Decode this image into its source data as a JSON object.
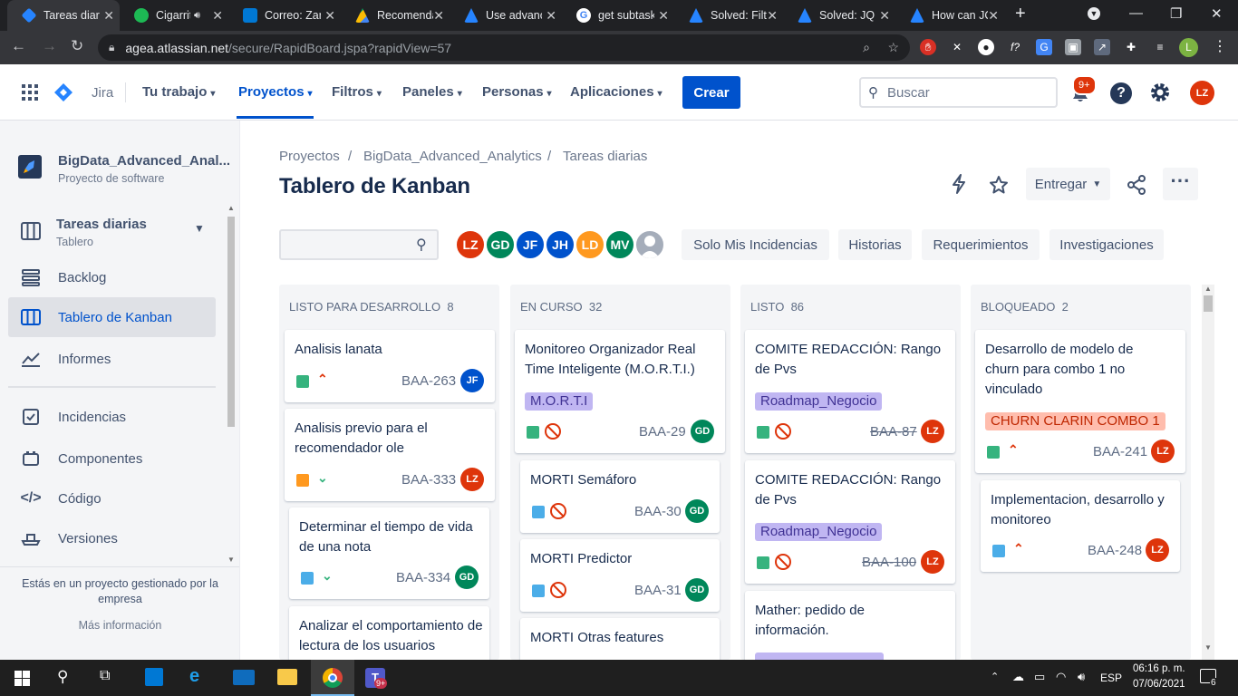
{
  "browser": {
    "tabs": [
      {
        "label": "Tareas diarias",
        "fav": "#2684ff",
        "active": true
      },
      {
        "label": "Cigarritos",
        "fav": "#1db954",
        "audio": true
      },
      {
        "label": "Correo: Zar",
        "fav": "#0078d4"
      },
      {
        "label": "Recomendac",
        "fav": "#fbbc04"
      },
      {
        "label": "Use advanced",
        "fav": "#2684ff"
      },
      {
        "label": "get subtasks",
        "fav": "#ffffff"
      },
      {
        "label": "Solved: Filter",
        "fav": "#2684ff"
      },
      {
        "label": "Solved: JQL",
        "fav": "#2684ff"
      },
      {
        "label": "How can JQL",
        "fav": "#2684ff"
      }
    ],
    "url_host": "agea.atlassian.net",
    "url_path": "/secure/RapidBoard.jspa?rapidView=57",
    "profile_initial": "L"
  },
  "header": {
    "product": "Jira",
    "nav": [
      {
        "label": "Tu trabajo",
        "selected": false
      },
      {
        "label": "Proyectos",
        "selected": true
      },
      {
        "label": "Filtros",
        "selected": false
      },
      {
        "label": "Paneles",
        "selected": false
      },
      {
        "label": "Personas",
        "selected": false
      },
      {
        "label": "Aplicaciones",
        "selected": false
      }
    ],
    "create_label": "Crear",
    "search_placeholder": "Buscar",
    "notif_badge": "9+",
    "user_initials": "LZ"
  },
  "sidebar": {
    "project_name": "BigData_Advanced_Anal...",
    "project_type": "Proyecto de software",
    "board_name": "Tareas diarias",
    "board_type": "Tablero",
    "items": [
      {
        "label": "Backlog",
        "icon": "backlog-icon"
      },
      {
        "label": "Tablero de Kanban",
        "icon": "board-icon",
        "selected": true
      },
      {
        "label": "Informes",
        "icon": "reports-icon"
      },
      {
        "label": "Incidencias",
        "icon": "issues-icon"
      },
      {
        "label": "Componentes",
        "icon": "components-icon"
      },
      {
        "label": "Código",
        "icon": "code-icon"
      },
      {
        "label": "Versiones",
        "icon": "releases-icon"
      }
    ],
    "footer_text": "Estás en un proyecto gestionado por la empresa",
    "more_info": "Más información"
  },
  "main": {
    "breadcrumb": [
      "Proyectos",
      "BigData_Advanced_Analytics",
      "Tareas diarias"
    ],
    "title": "Tablero de Kanban",
    "release_label": "Entregar",
    "avatars": [
      {
        "initials": "LZ",
        "color": "#de350b"
      },
      {
        "initials": "GD",
        "color": "#00875a"
      },
      {
        "initials": "JF",
        "color": "#0052cc"
      },
      {
        "initials": "JH",
        "color": "#0052cc"
      },
      {
        "initials": "LD",
        "color": "#ff991f"
      },
      {
        "initials": "MV",
        "color": "#00875a"
      }
    ],
    "quick_filters": [
      "Solo Mis Incidencias",
      "Historias",
      "Requerimientos",
      "Investigaciones"
    ],
    "columns": [
      {
        "name": "LISTO PARA DESARROLLO",
        "count": "8"
      },
      {
        "name": "EN CURSO",
        "count": "32"
      },
      {
        "name": "LISTO",
        "count": "86"
      },
      {
        "name": "BLOQUEADO",
        "count": "2"
      }
    ],
    "cards": {
      "c1": {
        "title": "Analisis lanata",
        "key": "BAA-263",
        "assignee": "JF"
      },
      "c2": {
        "title": "Analisis previo para el recomendador ole",
        "key": "BAA-333",
        "assignee": "LZ"
      },
      "c3": {
        "title": "Determinar el tiempo de vida de una nota",
        "key": "BAA-334",
        "assignee": "GD"
      },
      "c4": {
        "title": "Analizar el comportamiento de lectura de los usuarios",
        "key": "",
        "assignee": ""
      },
      "c5": {
        "title": "Monitoreo Organizador Real Time Inteligente (M.O.R.T.I.)",
        "epic": "M.O.R.T.I",
        "key": "BAA-29",
        "assignee": "GD"
      },
      "c6": {
        "title": "MORTI Semáforo",
        "key": "BAA-30",
        "assignee": "GD"
      },
      "c7": {
        "title": "MORTI Predictor",
        "key": "BAA-31",
        "assignee": "GD"
      },
      "c8": {
        "title": "MORTI Otras features",
        "key": "",
        "assignee": ""
      },
      "c9": {
        "title": "COMITE REDACCIÓN: Rango de Pvs",
        "epic": "Roadmap_Negocio",
        "key": "BAA-87",
        "assignee": "LZ"
      },
      "c10": {
        "title": "COMITE REDACCIÓN: Rango de Pvs",
        "epic": "Roadmap_Negocio",
        "key": "BAA-100",
        "assignee": "LZ"
      },
      "c11": {
        "title": "Mather: pedido de información.",
        "key": "",
        "assignee": ""
      },
      "c12": {
        "title": "Desarrollo de modelo de churn para combo 1 no vinculado",
        "epic": "CHURN CLARIN COMBO 1",
        "key": "BAA-241",
        "assignee": "LZ"
      },
      "c13": {
        "title": "Implementacion, desarrollo y monitoreo",
        "key": "BAA-248",
        "assignee": "LZ"
      }
    }
  },
  "taskbar": {
    "lang": "ESP",
    "time": "06:16 p. m.",
    "date": "07/06/2021",
    "notif_count": "6",
    "teams_badge": "9+"
  }
}
